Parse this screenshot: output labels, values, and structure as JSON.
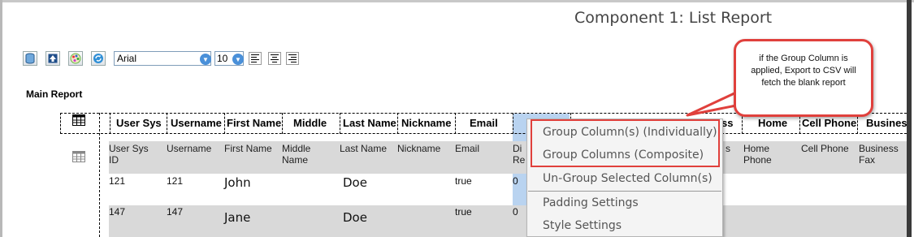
{
  "page_title": "Component 1: List Report",
  "toolbar": {
    "icons": [
      "database-icon",
      "upload-icon",
      "palette-icon",
      "refresh-icon"
    ],
    "font_family": "Arial",
    "font_size": "10",
    "align_icons": [
      "align-left-icon",
      "align-center-icon",
      "align-right-icon"
    ]
  },
  "section_label": "Main Report",
  "table": {
    "headers": [
      "User Sys",
      "Username",
      "First Name",
      "Middle",
      "Last Name",
      "Nickname",
      "Email",
      "",
      "",
      "ss",
      "Home",
      "Cell Phone",
      "Business"
    ],
    "subheaders": [
      "User Sys\nID",
      "Username",
      "First Name",
      "Middle\nName",
      "Last Name",
      "Nickname",
      "Email",
      "Di\nRe",
      "s",
      "Home\nPhone",
      "Cell Phone",
      "Business\nFax"
    ],
    "rows": [
      {
        "user_sys_id": "121",
        "username": "121",
        "first_name": "John",
        "last_name": "Doe",
        "email": "true",
        "col8": "0"
      },
      {
        "user_sys_id": "147",
        "username": "147",
        "first_name": "Jane",
        "last_name": "Doe",
        "email": "true",
        "col8": "0"
      }
    ]
  },
  "context_menu": {
    "items": [
      "Group Column(s) (Individually)",
      "Group Columns (Composite)",
      "Un-Group Selected Column(s)",
      "Padding Settings",
      "Style Settings"
    ]
  },
  "callout_text": "if the Group Column is applied, Export to CSV will fetch the blank report",
  "colors": {
    "callout_border": "#e0403c",
    "highlight_column": "#b9d3f0",
    "row_band": "#d9d9d9"
  }
}
